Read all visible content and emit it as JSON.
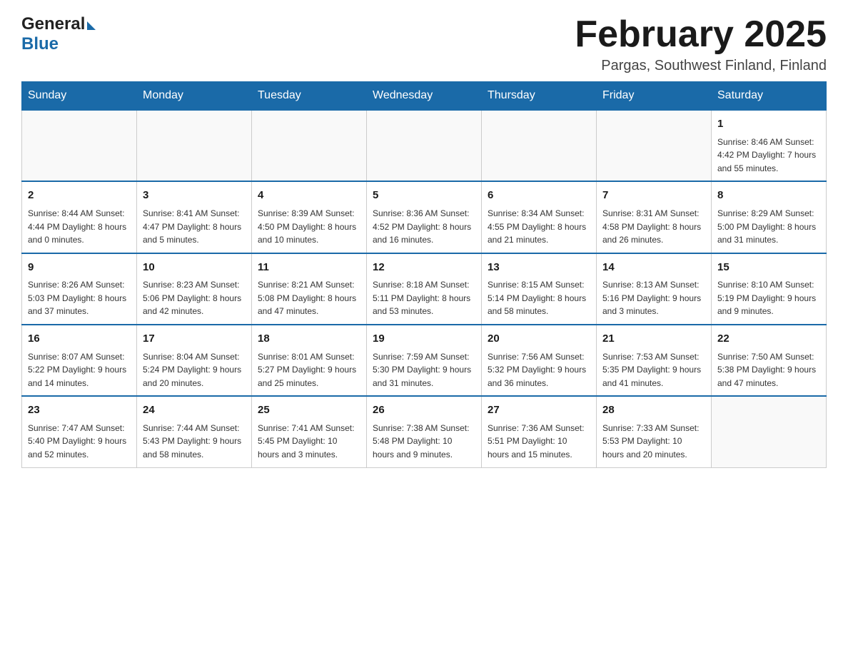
{
  "header": {
    "logo_general": "General",
    "logo_blue": "Blue",
    "month_title": "February 2025",
    "location": "Pargas, Southwest Finland, Finland"
  },
  "weekdays": [
    "Sunday",
    "Monday",
    "Tuesday",
    "Wednesday",
    "Thursday",
    "Friday",
    "Saturday"
  ],
  "weeks": [
    [
      {
        "day": "",
        "info": ""
      },
      {
        "day": "",
        "info": ""
      },
      {
        "day": "",
        "info": ""
      },
      {
        "day": "",
        "info": ""
      },
      {
        "day": "",
        "info": ""
      },
      {
        "day": "",
        "info": ""
      },
      {
        "day": "1",
        "info": "Sunrise: 8:46 AM\nSunset: 4:42 PM\nDaylight: 7 hours\nand 55 minutes."
      }
    ],
    [
      {
        "day": "2",
        "info": "Sunrise: 8:44 AM\nSunset: 4:44 PM\nDaylight: 8 hours\nand 0 minutes."
      },
      {
        "day": "3",
        "info": "Sunrise: 8:41 AM\nSunset: 4:47 PM\nDaylight: 8 hours\nand 5 minutes."
      },
      {
        "day": "4",
        "info": "Sunrise: 8:39 AM\nSunset: 4:50 PM\nDaylight: 8 hours\nand 10 minutes."
      },
      {
        "day": "5",
        "info": "Sunrise: 8:36 AM\nSunset: 4:52 PM\nDaylight: 8 hours\nand 16 minutes."
      },
      {
        "day": "6",
        "info": "Sunrise: 8:34 AM\nSunset: 4:55 PM\nDaylight: 8 hours\nand 21 minutes."
      },
      {
        "day": "7",
        "info": "Sunrise: 8:31 AM\nSunset: 4:58 PM\nDaylight: 8 hours\nand 26 minutes."
      },
      {
        "day": "8",
        "info": "Sunrise: 8:29 AM\nSunset: 5:00 PM\nDaylight: 8 hours\nand 31 minutes."
      }
    ],
    [
      {
        "day": "9",
        "info": "Sunrise: 8:26 AM\nSunset: 5:03 PM\nDaylight: 8 hours\nand 37 minutes."
      },
      {
        "day": "10",
        "info": "Sunrise: 8:23 AM\nSunset: 5:06 PM\nDaylight: 8 hours\nand 42 minutes."
      },
      {
        "day": "11",
        "info": "Sunrise: 8:21 AM\nSunset: 5:08 PM\nDaylight: 8 hours\nand 47 minutes."
      },
      {
        "day": "12",
        "info": "Sunrise: 8:18 AM\nSunset: 5:11 PM\nDaylight: 8 hours\nand 53 minutes."
      },
      {
        "day": "13",
        "info": "Sunrise: 8:15 AM\nSunset: 5:14 PM\nDaylight: 8 hours\nand 58 minutes."
      },
      {
        "day": "14",
        "info": "Sunrise: 8:13 AM\nSunset: 5:16 PM\nDaylight: 9 hours\nand 3 minutes."
      },
      {
        "day": "15",
        "info": "Sunrise: 8:10 AM\nSunset: 5:19 PM\nDaylight: 9 hours\nand 9 minutes."
      }
    ],
    [
      {
        "day": "16",
        "info": "Sunrise: 8:07 AM\nSunset: 5:22 PM\nDaylight: 9 hours\nand 14 minutes."
      },
      {
        "day": "17",
        "info": "Sunrise: 8:04 AM\nSunset: 5:24 PM\nDaylight: 9 hours\nand 20 minutes."
      },
      {
        "day": "18",
        "info": "Sunrise: 8:01 AM\nSunset: 5:27 PM\nDaylight: 9 hours\nand 25 minutes."
      },
      {
        "day": "19",
        "info": "Sunrise: 7:59 AM\nSunset: 5:30 PM\nDaylight: 9 hours\nand 31 minutes."
      },
      {
        "day": "20",
        "info": "Sunrise: 7:56 AM\nSunset: 5:32 PM\nDaylight: 9 hours\nand 36 minutes."
      },
      {
        "day": "21",
        "info": "Sunrise: 7:53 AM\nSunset: 5:35 PM\nDaylight: 9 hours\nand 41 minutes."
      },
      {
        "day": "22",
        "info": "Sunrise: 7:50 AM\nSunset: 5:38 PM\nDaylight: 9 hours\nand 47 minutes."
      }
    ],
    [
      {
        "day": "23",
        "info": "Sunrise: 7:47 AM\nSunset: 5:40 PM\nDaylight: 9 hours\nand 52 minutes."
      },
      {
        "day": "24",
        "info": "Sunrise: 7:44 AM\nSunset: 5:43 PM\nDaylight: 9 hours\nand 58 minutes."
      },
      {
        "day": "25",
        "info": "Sunrise: 7:41 AM\nSunset: 5:45 PM\nDaylight: 10 hours\nand 3 minutes."
      },
      {
        "day": "26",
        "info": "Sunrise: 7:38 AM\nSunset: 5:48 PM\nDaylight: 10 hours\nand 9 minutes."
      },
      {
        "day": "27",
        "info": "Sunrise: 7:36 AM\nSunset: 5:51 PM\nDaylight: 10 hours\nand 15 minutes."
      },
      {
        "day": "28",
        "info": "Sunrise: 7:33 AM\nSunset: 5:53 PM\nDaylight: 10 hours\nand 20 minutes."
      },
      {
        "day": "",
        "info": ""
      }
    ]
  ]
}
